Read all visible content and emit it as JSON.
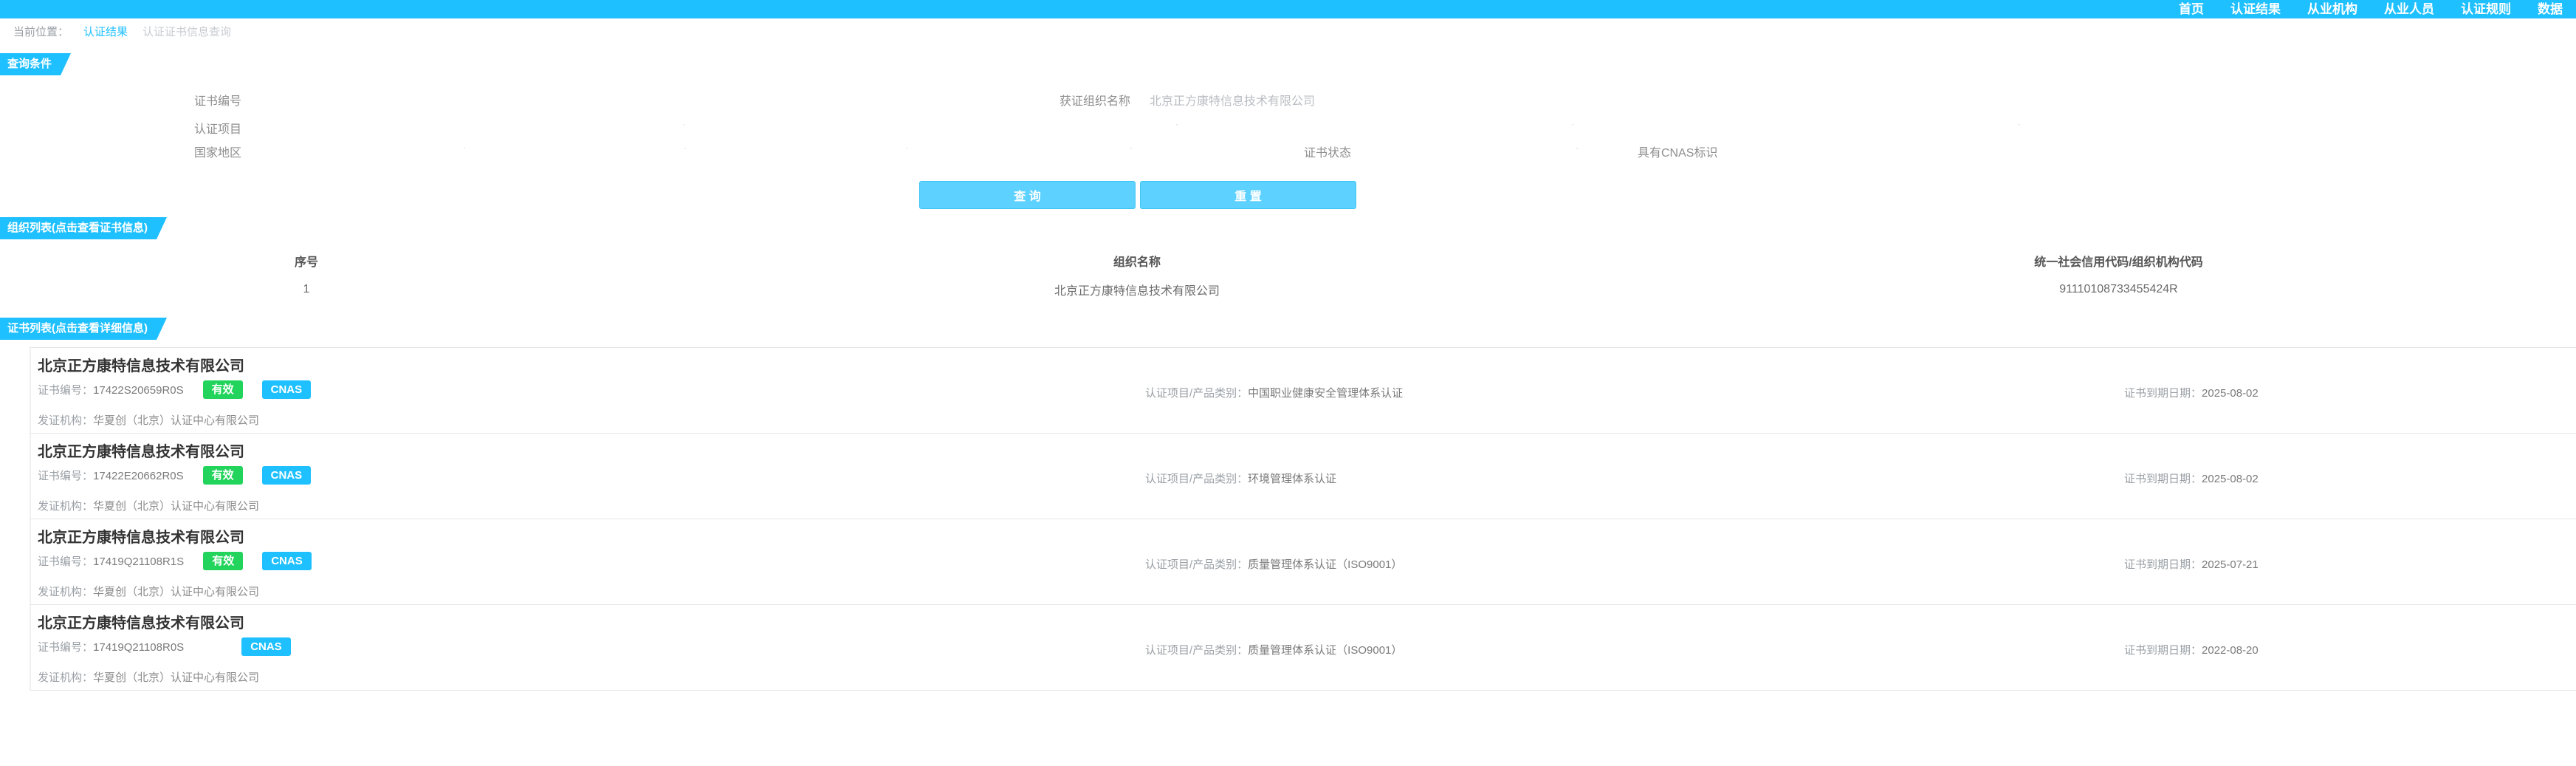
{
  "nav": {
    "items": [
      "首页",
      "认证结果",
      "从业机构",
      "从业人员",
      "认证规则",
      "数据"
    ]
  },
  "breadcrumb": {
    "prefix": "当前位置：",
    "current": "认证结果",
    "faint": "认证证书信息查询"
  },
  "query": {
    "section_title": "查询条件",
    "cert_no_label": "证书编号",
    "org_name_label": "获证组织名称",
    "org_name_value": "北京正方康特信息技术有限公司",
    "item_label": "认证项目",
    "region_label": "国家地区",
    "status_label": "证书状态",
    "cnas_label": "具有CNAS标识",
    "query_button": "查 询",
    "reset_button": "重 置"
  },
  "org_list": {
    "section_title": "组织列表(点击查看证书信息)",
    "headers": [
      "序号",
      "组织名称",
      "统一社会信用代码/组织机构代码"
    ],
    "rows": [
      [
        "1",
        "北京正方康特信息技术有限公司",
        "91110108733455424R"
      ]
    ]
  },
  "cert_list": {
    "section_title": "证书列表(点击查看详细信息)",
    "cert_no_prefix": "证书编号：",
    "issuer_prefix": "发证机构：",
    "item_prefix": "认证项目/产品类别：",
    "expiry_prefix": "证书到期日期：",
    "items": [
      {
        "company": "北京正方康特信息技术有限公司",
        "cert_no": "17422S20659R0S",
        "status": "有效",
        "cnas": "CNAS",
        "item": "中国职业健康安全管理体系认证",
        "expiry": "2025-08-02",
        "issuer": "华夏创（北京）认证中心有限公司"
      },
      {
        "company": "北京正方康特信息技术有限公司",
        "cert_no": "17422E20662R0S",
        "status": "有效",
        "cnas": "CNAS",
        "item": "环境管理体系认证",
        "expiry": "2025-08-02",
        "issuer": "华夏创（北京）认证中心有限公司"
      },
      {
        "company": "北京正方康特信息技术有限公司",
        "cert_no": "17419Q21108R1S",
        "status": "有效",
        "cnas": "CNAS",
        "item": "质量管理体系认证（ISO9001）",
        "expiry": "2025-07-21",
        "issuer": "华夏创（北京）认证中心有限公司"
      },
      {
        "company": "北京正方康特信息技术有限公司",
        "cert_no": "17419Q21108R0S",
        "status": "",
        "cnas": "CNAS",
        "item": "质量管理体系认证（ISO9001）",
        "expiry": "2022-08-20",
        "issuer": "华夏创（北京）认证中心有限公司"
      }
    ]
  }
}
